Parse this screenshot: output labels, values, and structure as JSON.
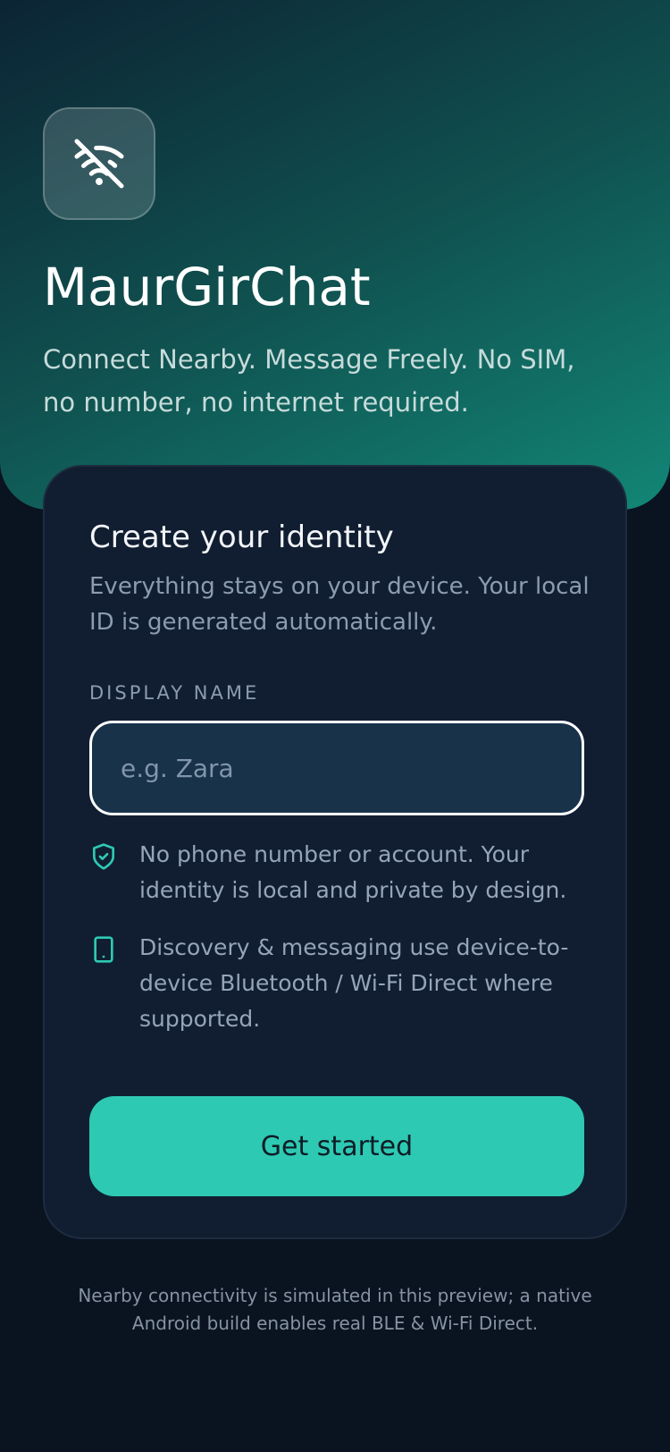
{
  "header": {
    "app_icon": "wifi-off-icon",
    "title": "MaurGirChat",
    "tagline": "Connect Nearby. Message Freely. No SIM, no number, no internet required."
  },
  "identity_card": {
    "title": "Create your identity",
    "subtitle": "Everything stays on your device. Your local ID is generated automatically.",
    "display_name": {
      "label": "DISPLAY NAME",
      "placeholder": "e.g. Zara",
      "value": ""
    },
    "info_items": [
      {
        "icon": "shield-check-icon",
        "text": "No phone number or account. Your identity is local and private by design."
      },
      {
        "icon": "phone-icon",
        "text": "Discovery & messaging use device-to-device Bluetooth / Wi-Fi Direct where supported."
      }
    ],
    "cta_label": "Get started"
  },
  "footer": {
    "note": "Nearby connectivity is simulated in this preview; a native Android build enables real BLE & Wi-Fi Direct."
  },
  "colors": {
    "background": "#0a1320",
    "hero_gradient_start": "#0c2434",
    "hero_gradient_end": "#128676",
    "card": "#111e31",
    "accent": "#2ec9b3",
    "input_fill": "#18324a"
  }
}
